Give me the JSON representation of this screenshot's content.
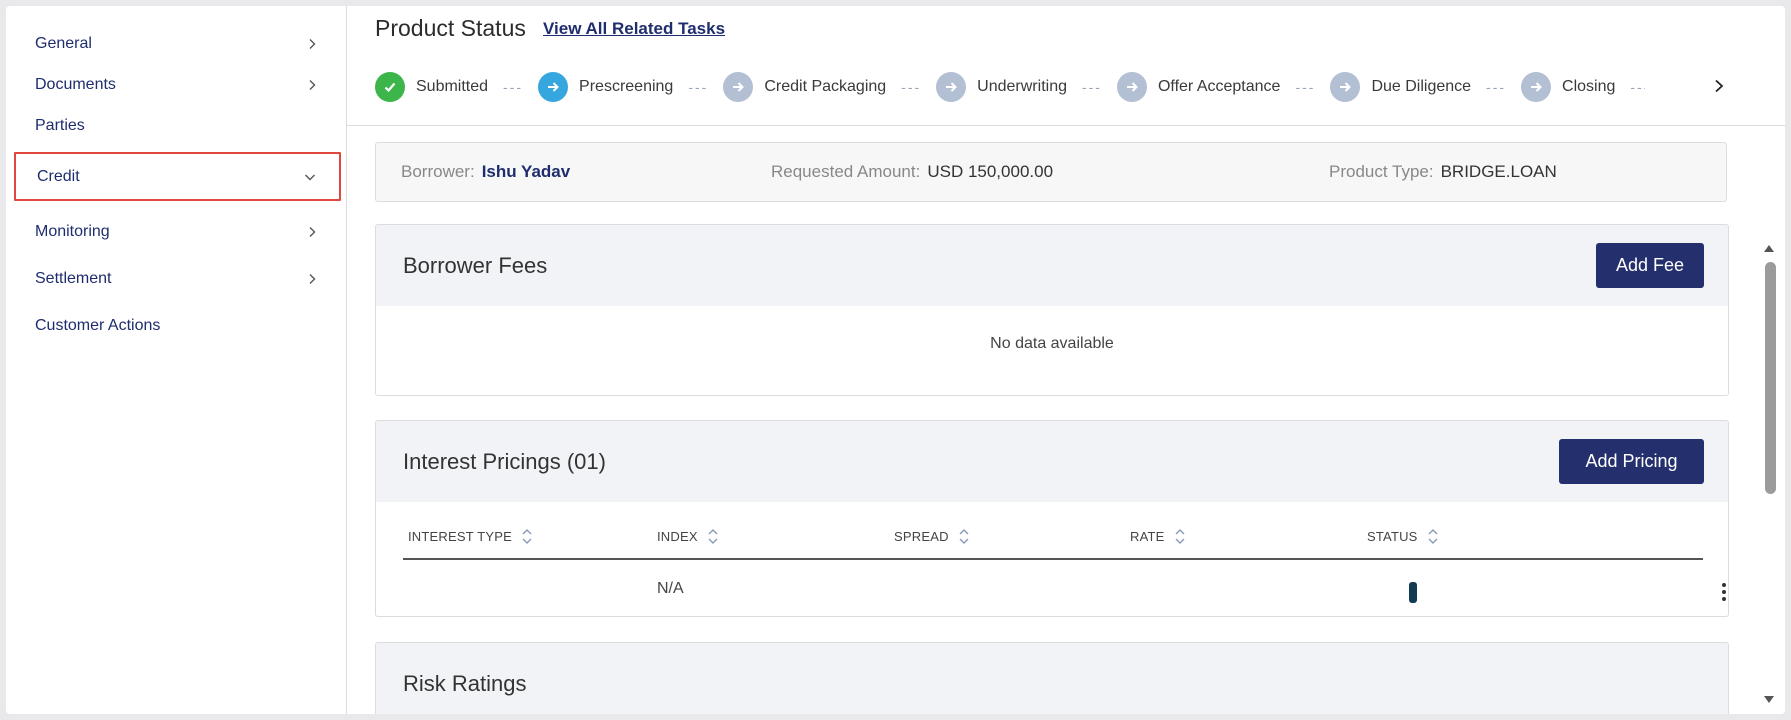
{
  "sidebar": {
    "items": [
      {
        "label": "General",
        "chevron": "right"
      },
      {
        "label": "Documents",
        "chevron": "right"
      },
      {
        "label": "Parties",
        "chevron": "none"
      },
      {
        "label": "Credit",
        "chevron": "down",
        "active": true
      },
      {
        "label": "Monitoring",
        "chevron": "right"
      },
      {
        "label": "Settlement",
        "chevron": "right"
      },
      {
        "label": "Customer Actions",
        "chevron": "none"
      }
    ]
  },
  "product_status": {
    "title": "Product Status",
    "link": "View All Related Tasks",
    "steps": [
      {
        "label": "Submitted",
        "state": "done"
      },
      {
        "label": "Prescreening",
        "state": "current"
      },
      {
        "label": "Credit Packaging",
        "state": "pending"
      },
      {
        "label": "Underwriting",
        "state": "pending"
      },
      {
        "label": "Offer Acceptance",
        "state": "pending"
      },
      {
        "label": "Due Diligence",
        "state": "pending"
      },
      {
        "label": "Closing",
        "state": "pending"
      }
    ],
    "separator": "---"
  },
  "summary": {
    "borrower_label": "Borrower:",
    "borrower_value": "Ishu Yadav",
    "amount_label": "Requested Amount:",
    "amount_value": "USD 150,000.00",
    "type_label": "Product Type:",
    "type_value": "BRIDGE.LOAN"
  },
  "borrower_fees": {
    "title": "Borrower Fees",
    "button": "Add Fee",
    "empty": "No data available"
  },
  "interest_pricings": {
    "title": "Interest Pricings (01)",
    "button": "Add Pricing",
    "columns": [
      "INTEREST TYPE",
      "INDEX",
      "SPREAD",
      "RATE",
      "STATUS"
    ],
    "rows": [
      {
        "interest_type": "",
        "index": "N/A",
        "spread": "",
        "rate": "",
        "status": ""
      }
    ]
  },
  "risk_ratings": {
    "title": "Risk Ratings"
  },
  "colors": {
    "primary_button": "#24306d",
    "nav_text": "#1f2d6e",
    "step_done": "#3cb54a",
    "step_current": "#35a6de",
    "step_pending": "#b3bfd3",
    "active_outline": "#e0473f"
  }
}
